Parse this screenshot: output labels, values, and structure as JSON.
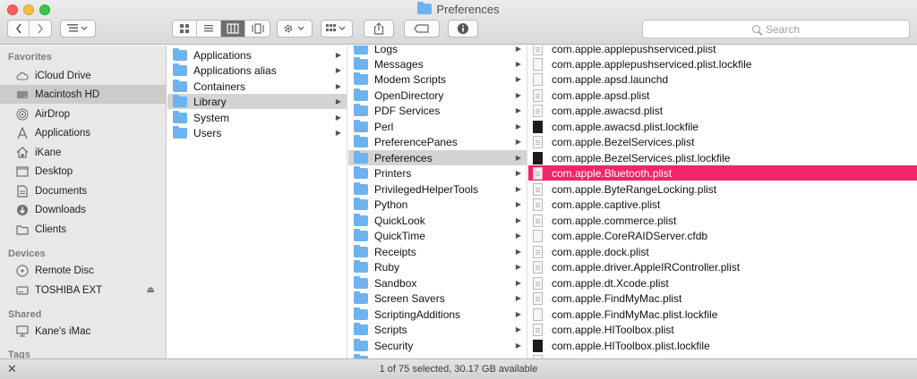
{
  "window": {
    "title": "Preferences",
    "colors": {
      "selection_pink": "#f2246a",
      "folder_blue": "#6cb3f0"
    }
  },
  "toolbar": {
    "search_placeholder": "Search",
    "view_modes": [
      "icon-view-icon",
      "list-view-icon",
      "column-view-icon",
      "coverflow-view-icon"
    ],
    "active_view": "column-view-icon"
  },
  "sidebar": {
    "favorites_header": "Favorites",
    "favorites": [
      {
        "label": "iCloud Drive",
        "icon": "cloud-icon"
      },
      {
        "label": "Macintosh HD",
        "icon": "harddrive-icon",
        "selected": true
      },
      {
        "label": "AirDrop",
        "icon": "airdrop-icon"
      },
      {
        "label": "Applications",
        "icon": "applications-icon"
      },
      {
        "label": "iKane",
        "icon": "home-icon"
      },
      {
        "label": "Desktop",
        "icon": "desktop-icon"
      },
      {
        "label": "Documents",
        "icon": "documents-icon"
      },
      {
        "label": "Downloads",
        "icon": "downloads-icon"
      },
      {
        "label": "Clients",
        "icon": "folder-icon"
      }
    ],
    "devices_header": "Devices",
    "devices": [
      {
        "label": "Remote Disc",
        "icon": "disc-icon"
      },
      {
        "label": "TOSHIBA EXT",
        "icon": "external-drive-icon"
      }
    ],
    "shared_header": "Shared",
    "shared": [
      {
        "label": "Kane's iMac",
        "icon": "imac-icon"
      }
    ],
    "tags_header": "Tags"
  },
  "column1": [
    "Applications",
    "Applications alias",
    "Containers",
    "Library",
    "System",
    "Users"
  ],
  "column2": [
    "Logs",
    "Messages",
    "Modem Scripts",
    "OpenDirectory",
    "PDF Services",
    "Perl",
    "PreferencePanes",
    "Preferences",
    "Printers",
    "PrivilegedHelperTools",
    "Python",
    "QuickLook",
    "QuickTime",
    "Receipts",
    "Ruby",
    "Sandbox",
    "Screen Savers",
    "ScriptingAdditions",
    "Scripts",
    "Security"
  ],
  "column3": [
    {
      "name": "com.apple.applepushserviced.plist",
      "icon": "plist"
    },
    {
      "name": "com.apple.applepushserviced.plist.lockfile",
      "icon": "blank"
    },
    {
      "name": "com.apple.apsd.launchd",
      "icon": "blank"
    },
    {
      "name": "com.apple.apsd.plist",
      "icon": "plist"
    },
    {
      "name": "com.apple.awacsd.plist",
      "icon": "plist"
    },
    {
      "name": "com.apple.awacsd.plist.lockfile",
      "icon": "dark"
    },
    {
      "name": "com.apple.BezelServices.plist",
      "icon": "plist"
    },
    {
      "name": "com.apple.BezelServices.plist.lockfile",
      "icon": "dark"
    },
    {
      "name": "com.apple.Bluetooth.plist",
      "icon": "plist",
      "selected": true
    },
    {
      "name": "com.apple.ByteRangeLocking.plist",
      "icon": "plist"
    },
    {
      "name": "com.apple.captive.plist",
      "icon": "plist"
    },
    {
      "name": "com.apple.commerce.plist",
      "icon": "plist"
    },
    {
      "name": "com.apple.CoreRAIDServer.cfdb",
      "icon": "blank"
    },
    {
      "name": "com.apple.dock.plist",
      "icon": "plist"
    },
    {
      "name": "com.apple.driver.AppleIRController.plist",
      "icon": "plist"
    },
    {
      "name": "com.apple.dt.Xcode.plist",
      "icon": "plist"
    },
    {
      "name": "com.apple.FindMyMac.plist",
      "icon": "plist"
    },
    {
      "name": "com.apple.FindMyMac.plist.lockfile",
      "icon": "blank"
    },
    {
      "name": "com.apple.HIToolbox.plist",
      "icon": "plist"
    },
    {
      "name": "com.apple.HIToolbox.plist.lockfile",
      "icon": "dark"
    }
  ],
  "status": {
    "text": "1 of 75 selected, 30.17 GB available"
  }
}
